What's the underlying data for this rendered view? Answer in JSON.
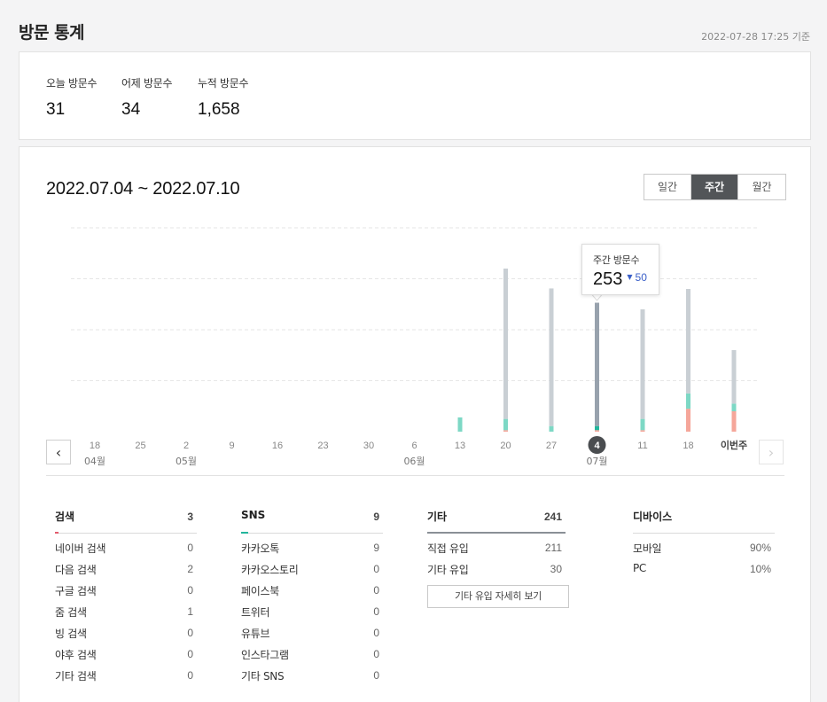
{
  "header": {
    "title": "방문 통계",
    "timestamp": "2022-07-28 17:25 기준"
  },
  "summary": [
    {
      "label": "오늘 방문수",
      "value": "31"
    },
    {
      "label": "어제 방문수",
      "value": "34"
    },
    {
      "label": "누적 방문수",
      "value": "1,658"
    }
  ],
  "range_title": "2022.07.04 ~ 2022.07.10",
  "period_tabs": [
    {
      "label": "일간",
      "active": false
    },
    {
      "label": "주간",
      "active": true
    },
    {
      "label": "월간",
      "active": false
    }
  ],
  "tooltip": {
    "label": "주간 방문수",
    "value": "253",
    "delta_arrow": "▼",
    "delta": "50"
  },
  "colors": {
    "direct": "#c9cfd4",
    "direct_selected": "#98a2ad",
    "sns": "#7dd8c5",
    "search": "#f5a69a",
    "search_accent": "#e35a6c",
    "sns_accent": "#22b59c",
    "other_accent": "#8a9096",
    "grid": "#e6e6e6",
    "tab_active_bg": "#525558"
  },
  "chart_data": {
    "type": "bar",
    "stacked": true,
    "categories": [
      "18",
      "25",
      "2",
      "9",
      "16",
      "23",
      "30",
      "6",
      "13",
      "20",
      "27",
      "4",
      "11",
      "18",
      "이번주"
    ],
    "month_labels": [
      "04월",
      "",
      "05월",
      "",
      "",
      "",
      "",
      "06월",
      "",
      "",
      "",
      "07월",
      "",
      "",
      ""
    ],
    "selected_index": 11,
    "series": [
      {
        "name": "검색",
        "values": [
          0,
          0,
          0,
          0,
          0,
          0,
          0,
          0,
          0,
          3,
          0,
          3,
          3,
          45,
          40
        ]
      },
      {
        "name": "SNS",
        "values": [
          0,
          0,
          0,
          0,
          0,
          0,
          0,
          0,
          28,
          22,
          11,
          8,
          22,
          30,
          15
        ]
      },
      {
        "name": "기타",
        "values": [
          0,
          0,
          0,
          0,
          0,
          0,
          0,
          0,
          0,
          295,
          270,
          242,
          215,
          205,
          105
        ]
      }
    ],
    "ylim": [
      0,
      400
    ],
    "grid": true
  },
  "stats": {
    "search": {
      "title": "검색",
      "total": "3",
      "rows": [
        {
          "label": "네이버 검색",
          "value": "0"
        },
        {
          "label": "다음 검색",
          "value": "2"
        },
        {
          "label": "구글 검색",
          "value": "0"
        },
        {
          "label": "줌 검색",
          "value": "1"
        },
        {
          "label": "빙 검색",
          "value": "0"
        },
        {
          "label": "야후 검색",
          "value": "0"
        },
        {
          "label": "기타 검색",
          "value": "0"
        }
      ]
    },
    "sns": {
      "title": "SNS",
      "total": "9",
      "rows": [
        {
          "label": "카카오톡",
          "value": "9"
        },
        {
          "label": "카카오스토리",
          "value": "0"
        },
        {
          "label": "페이스북",
          "value": "0"
        },
        {
          "label": "트위터",
          "value": "0"
        },
        {
          "label": "유튜브",
          "value": "0"
        },
        {
          "label": "인스타그램",
          "value": "0"
        },
        {
          "label": "기타 SNS",
          "value": "0"
        }
      ]
    },
    "other": {
      "title": "기타",
      "total": "241",
      "rows": [
        {
          "label": "직접 유입",
          "value": "211"
        },
        {
          "label": "기타 유입",
          "value": "30"
        }
      ],
      "detail_button": "기타 유입 자세히 보기"
    },
    "device": {
      "title": "디바이스",
      "rows": [
        {
          "label": "모바일",
          "value": "90%"
        },
        {
          "label": "PC",
          "value": "10%"
        }
      ]
    }
  }
}
